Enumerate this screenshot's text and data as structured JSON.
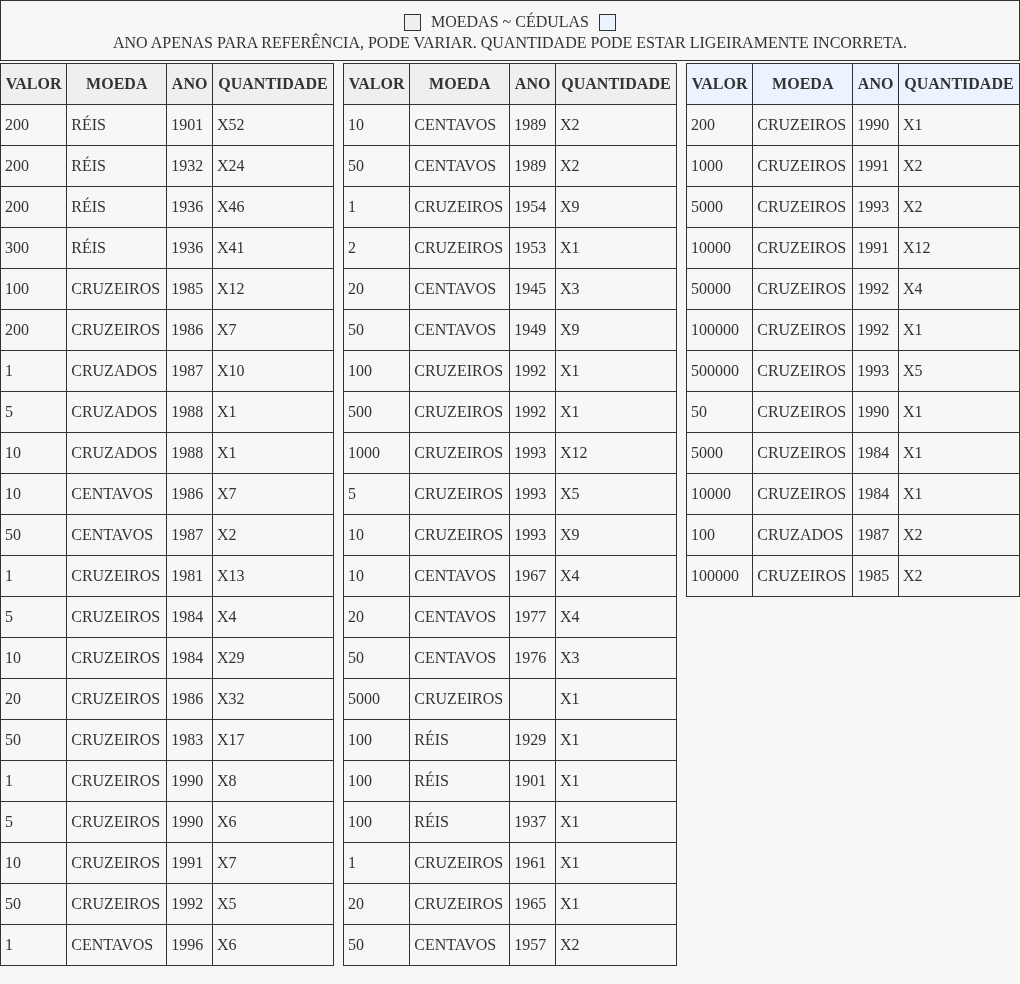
{
  "legend": {
    "swatches": [
      {
        "color": "#efefef"
      },
      {
        "color": "#eaf3ff"
      }
    ],
    "text": "MOEDAS ~ CÉDULAS"
  },
  "note": "ANO APENAS PARA REFERÊNCIA, PODE VARIAR. QUANTIDADE PODE ESTAR LIGEIRAMENTE INCORRETA.",
  "tables": [
    {
      "kind": "moedas",
      "columns": [
        "VALOR",
        "MOEDA",
        "ANO",
        "QUANTIDADE"
      ],
      "rows": [
        {
          "valor": "200",
          "moeda": "RÉIS",
          "ano": "1901",
          "quantidade": "X52"
        },
        {
          "valor": "200",
          "moeda": "RÉIS",
          "ano": "1932",
          "quantidade": "X24"
        },
        {
          "valor": "200",
          "moeda": "RÉIS",
          "ano": "1936",
          "quantidade": "X46"
        },
        {
          "valor": "300",
          "moeda": "RÉIS",
          "ano": "1936",
          "quantidade": "X41"
        },
        {
          "valor": "100",
          "moeda": "CRUZEIROS",
          "ano": "1985",
          "quantidade": "X12"
        },
        {
          "valor": "200",
          "moeda": "CRUZEIROS",
          "ano": "1986",
          "quantidade": "X7"
        },
        {
          "valor": "1",
          "moeda": "CRUZADOS",
          "ano": "1987",
          "quantidade": "X10"
        },
        {
          "valor": "5",
          "moeda": "CRUZADOS",
          "ano": "1988",
          "quantidade": "X1"
        },
        {
          "valor": "10",
          "moeda": "CRUZADOS",
          "ano": "1988",
          "quantidade": "X1"
        },
        {
          "valor": "10",
          "moeda": "CENTAVOS",
          "ano": "1986",
          "quantidade": "X7"
        },
        {
          "valor": "50",
          "moeda": "CENTAVOS",
          "ano": "1987",
          "quantidade": "X2"
        },
        {
          "valor": "1",
          "moeda": "CRUZEIROS",
          "ano": "1981",
          "quantidade": "X13"
        },
        {
          "valor": "5",
          "moeda": "CRUZEIROS",
          "ano": "1984",
          "quantidade": "X4"
        },
        {
          "valor": "10",
          "moeda": "CRUZEIROS",
          "ano": "1984",
          "quantidade": "X29"
        },
        {
          "valor": "20",
          "moeda": "CRUZEIROS",
          "ano": "1986",
          "quantidade": "X32"
        },
        {
          "valor": "50",
          "moeda": "CRUZEIROS",
          "ano": "1983",
          "quantidade": "X17"
        },
        {
          "valor": "1",
          "moeda": "CRUZEIROS",
          "ano": "1990",
          "quantidade": "X8"
        },
        {
          "valor": "5",
          "moeda": "CRUZEIROS",
          "ano": "1990",
          "quantidade": "X6"
        },
        {
          "valor": "10",
          "moeda": "CRUZEIROS",
          "ano": "1991",
          "quantidade": "X7"
        },
        {
          "valor": "50",
          "moeda": "CRUZEIROS",
          "ano": "1992",
          "quantidade": "X5"
        },
        {
          "valor": "1",
          "moeda": "CENTAVOS",
          "ano": "1996",
          "quantidade": "X6"
        }
      ]
    },
    {
      "kind": "moedas",
      "columns": [
        "VALOR",
        "MOEDA",
        "ANO",
        "QUANTIDADE"
      ],
      "rows": [
        {
          "valor": "10",
          "moeda": "CENTAVOS",
          "ano": "1989",
          "quantidade": "X2"
        },
        {
          "valor": "50",
          "moeda": "CENTAVOS",
          "ano": "1989",
          "quantidade": "X2"
        },
        {
          "valor": "1",
          "moeda": "CRUZEIROS",
          "ano": "1954",
          "quantidade": "X9"
        },
        {
          "valor": "2",
          "moeda": "CRUZEIROS",
          "ano": "1953",
          "quantidade": "X1"
        },
        {
          "valor": "20",
          "moeda": "CENTAVOS",
          "ano": "1945",
          "quantidade": "X3"
        },
        {
          "valor": "50",
          "moeda": "CENTAVOS",
          "ano": "1949",
          "quantidade": "X9"
        },
        {
          "valor": "100",
          "moeda": "CRUZEIROS",
          "ano": "1992",
          "quantidade": "X1"
        },
        {
          "valor": "500",
          "moeda": "CRUZEIROS",
          "ano": "1992",
          "quantidade": "X1"
        },
        {
          "valor": "1000",
          "moeda": "CRUZEIROS",
          "ano": "1993",
          "quantidade": "X12"
        },
        {
          "valor": "5",
          "moeda": "CRUZEIROS",
          "ano": "1993",
          "quantidade": "X5"
        },
        {
          "valor": "10",
          "moeda": "CRUZEIROS",
          "ano": "1993",
          "quantidade": "X9"
        },
        {
          "valor": "10",
          "moeda": "CENTAVOS",
          "ano": "1967",
          "quantidade": "X4"
        },
        {
          "valor": "20",
          "moeda": "CENTAVOS",
          "ano": "1977",
          "quantidade": "X4"
        },
        {
          "valor": "50",
          "moeda": "CENTAVOS",
          "ano": "1976",
          "quantidade": "X3"
        },
        {
          "valor": "5000",
          "moeda": "CRUZEIROS",
          "quantidade": "X1"
        },
        {
          "valor": "100",
          "moeda": "RÉIS",
          "ano": "1929",
          "quantidade": "X1"
        },
        {
          "valor": "100",
          "moeda": "RÉIS",
          "ano": "1901",
          "quantidade": "X1"
        },
        {
          "valor": "100",
          "moeda": "RÉIS",
          "ano": "1937",
          "quantidade": "X1"
        },
        {
          "valor": "1",
          "moeda": "CRUZEIROS",
          "ano": "1961",
          "quantidade": "X1"
        },
        {
          "valor": "20",
          "moeda": "CRUZEIROS",
          "ano": "1965",
          "quantidade": "X1"
        },
        {
          "valor": "50",
          "moeda": "CENTAVOS",
          "ano": "1957",
          "quantidade": "X2"
        }
      ]
    },
    {
      "kind": "cedulas",
      "columns": [
        "VALOR",
        "MOEDA",
        "ANO",
        "QUANTIDADE"
      ],
      "rows": [
        {
          "valor": "200",
          "moeda": "CRUZEIROS",
          "ano": "1990",
          "quantidade": "X1"
        },
        {
          "valor": "1000",
          "moeda": "CRUZEIROS",
          "ano": "1991",
          "quantidade": "X2"
        },
        {
          "valor": "5000",
          "moeda": "CRUZEIROS",
          "ano": "1993",
          "quantidade": "X2"
        },
        {
          "valor": "10000",
          "moeda": "CRUZEIROS",
          "ano": "1991",
          "quantidade": "X12"
        },
        {
          "valor": "50000",
          "moeda": "CRUZEIROS",
          "ano": "1992",
          "quantidade": "X4"
        },
        {
          "valor": "100000",
          "moeda": "CRUZEIROS",
          "ano": "1992",
          "quantidade": "X1"
        },
        {
          "valor": "500000",
          "moeda": "CRUZEIROS",
          "ano": "1993",
          "quantidade": "X5"
        },
        {
          "valor": "50",
          "moeda": "CRUZEIROS",
          "ano": "1990",
          "quantidade": "X1"
        },
        {
          "valor": "5000",
          "moeda": "CRUZEIROS",
          "ano": "1984",
          "quantidade": "X1"
        },
        {
          "valor": "10000",
          "moeda": "CRUZEIROS",
          "ano": "1984",
          "quantidade": "X1"
        },
        {
          "valor": "100",
          "moeda": "CRUZADOS",
          "ano": "1987",
          "quantidade": "X2"
        },
        {
          "valor": "100000",
          "moeda": "CRUZEIROS",
          "ano": "1985",
          "quantidade": "X2"
        }
      ]
    }
  ]
}
